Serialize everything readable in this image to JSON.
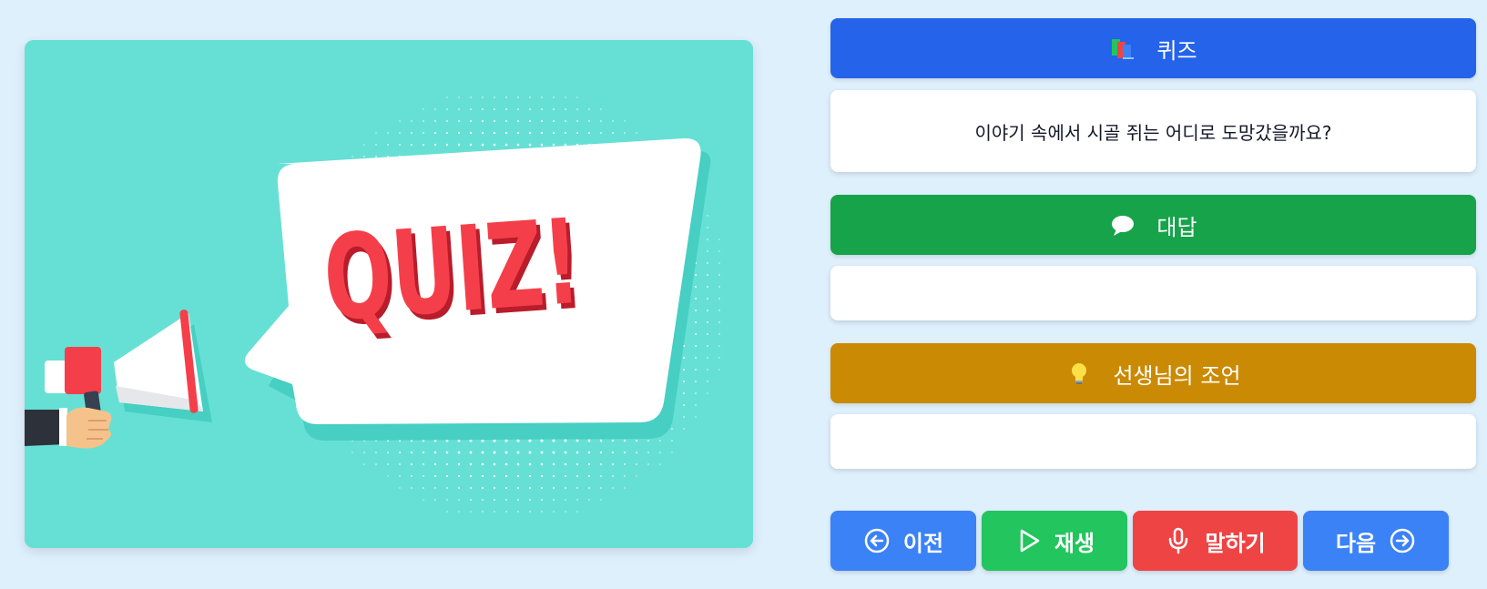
{
  "illustration": {
    "word": "QUIZ!",
    "colors": {
      "background": "#66e0d5",
      "bubble": "#ffffff",
      "text": "#f43f4a",
      "dots": "#ffffff"
    }
  },
  "quiz": {
    "header_label": "퀴즈",
    "icon": "books-icon",
    "question": "이야기 속에서 시골 쥐는 어디로 도망갔을까요?",
    "color": "#2563eb"
  },
  "answer": {
    "header_label": "대답",
    "icon": "speech-bubble-icon",
    "value": "",
    "color": "#16a34a"
  },
  "advice": {
    "header_label": "선생님의 조언",
    "icon": "lightbulb-icon",
    "value": "",
    "color": "#ca8a04"
  },
  "buttons": {
    "prev_label": "이전",
    "play_label": "재생",
    "speak_label": "말하기",
    "next_label": "다음"
  }
}
